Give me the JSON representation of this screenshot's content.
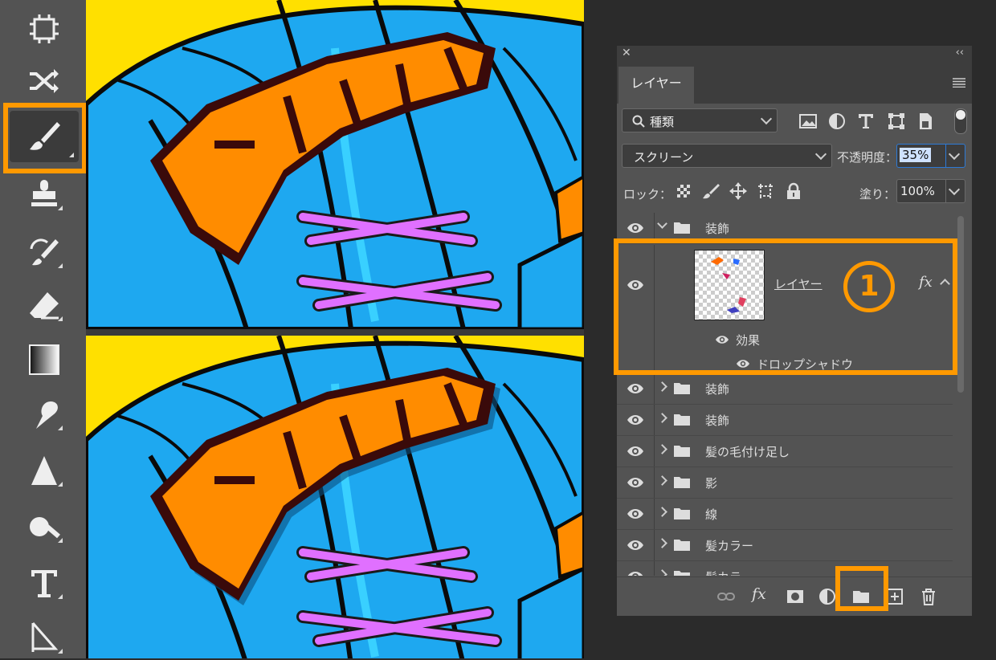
{
  "panel": {
    "close_glyph": "✕",
    "collapse_glyph": "‹‹",
    "tab_label": "レイヤー",
    "filter": {
      "label": "種類"
    },
    "blend_mode": "スクリーン",
    "opacity_label": "不透明度：",
    "opacity_value": "35%",
    "lock_label": "ロック：",
    "fill_label": "塗り：",
    "fill_value": "100%",
    "group_open_name": "装飾",
    "selected_layer": {
      "name": "レイヤー",
      "fx_label": "fx",
      "effects_label": "効果",
      "effect_name": "ドロップシャドウ"
    },
    "badge": "1",
    "layers": [
      {
        "name": "装飾"
      },
      {
        "name": "装飾"
      },
      {
        "name": "髪の毛付け足し"
      },
      {
        "name": "影"
      },
      {
        "name": "線"
      },
      {
        "name": "髪カラー"
      },
      {
        "name": "髪カラー"
      }
    ],
    "bottom_fx": "fx"
  },
  "colors": {
    "highlight": "#ff9900",
    "panel_bg": "#535353",
    "hair_blue": "#1ea8f0",
    "logo_orange": "#ff8c00",
    "ribbon_pink": "#e070ff",
    "background_yellow": "#ffe000"
  },
  "icons": [
    "artboard-icon",
    "shuffle-icon",
    "brush-icon",
    "stamp-icon",
    "history-brush-icon",
    "eraser-icon",
    "gradient-icon",
    "smudge-icon",
    "sharpen-icon",
    "dodge-icon",
    "type-icon",
    "path-select-icon",
    "eye-icon",
    "folder-icon",
    "link-icon",
    "mask-icon",
    "adjustment-icon",
    "trash-icon"
  ]
}
